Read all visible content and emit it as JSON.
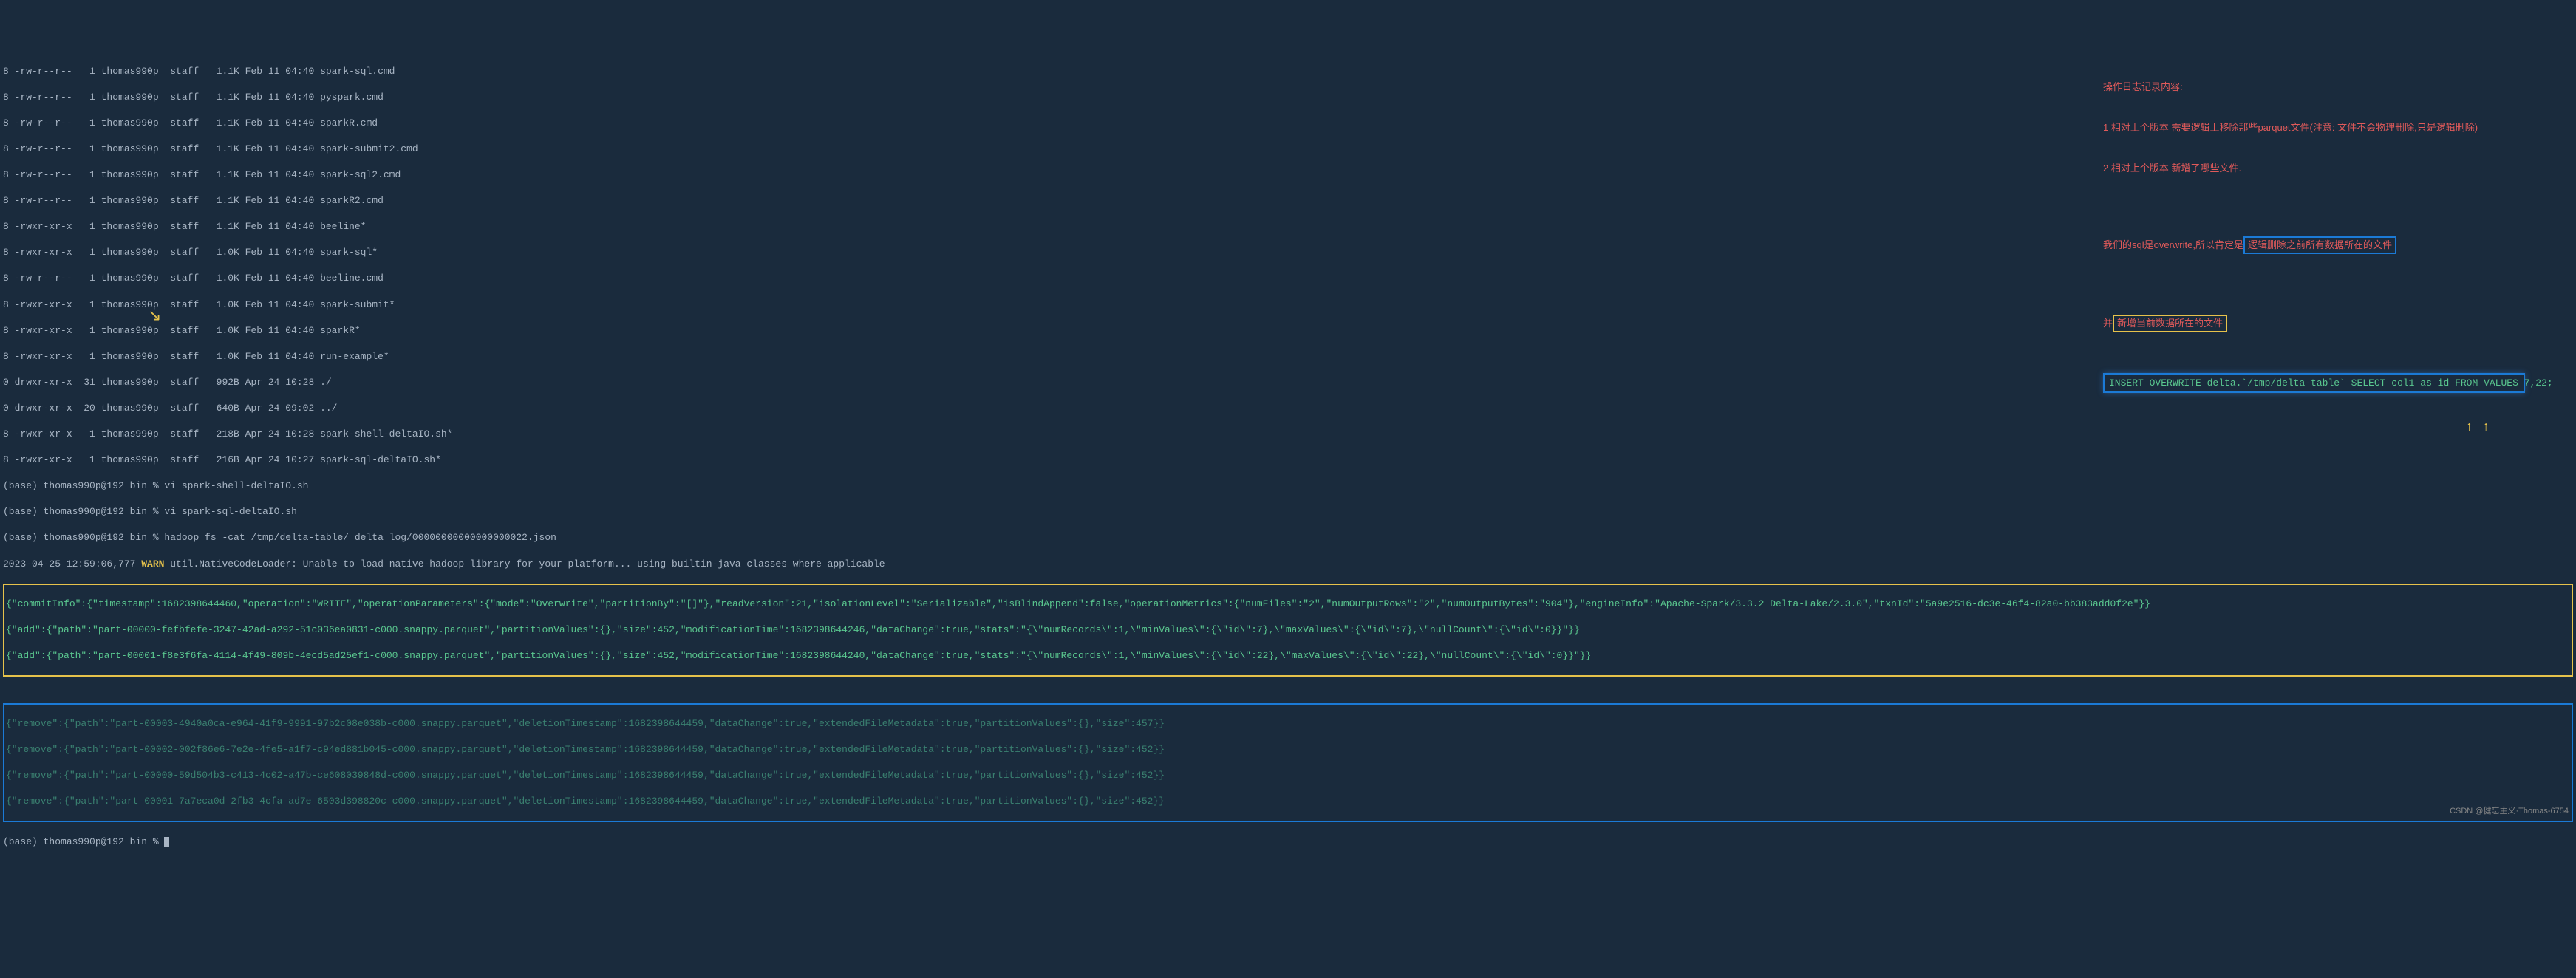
{
  "listing": [
    "8 -rw-r--r--   1 thomas990p  staff   1.1K Feb 11 04:40 spark-sql.cmd",
    "8 -rw-r--r--   1 thomas990p  staff   1.1K Feb 11 04:40 pyspark.cmd",
    "8 -rw-r--r--   1 thomas990p  staff   1.1K Feb 11 04:40 sparkR.cmd",
    "8 -rw-r--r--   1 thomas990p  staff   1.1K Feb 11 04:40 spark-submit2.cmd",
    "8 -rw-r--r--   1 thomas990p  staff   1.1K Feb 11 04:40 spark-sql2.cmd",
    "8 -rw-r--r--   1 thomas990p  staff   1.1K Feb 11 04:40 sparkR2.cmd",
    "8 -rwxr-xr-x   1 thomas990p  staff   1.1K Feb 11 04:40 beeline*",
    "8 -rwxr-xr-x   1 thomas990p  staff   1.0K Feb 11 04:40 spark-sql*",
    "8 -rw-r--r--   1 thomas990p  staff   1.0K Feb 11 04:40 beeline.cmd",
    "8 -rwxr-xr-x   1 thomas990p  staff   1.0K Feb 11 04:40 spark-submit*",
    "8 -rwxr-xr-x   1 thomas990p  staff   1.0K Feb 11 04:40 sparkR*",
    "8 -rwxr-xr-x   1 thomas990p  staff   1.0K Feb 11 04:40 run-example*",
    "0 drwxr-xr-x  31 thomas990p  staff   992B Apr 24 10:28 ./",
    "0 drwxr-xr-x  20 thomas990p  staff   640B Apr 24 09:02 ../",
    "8 -rwxr-xr-x   1 thomas990p  staff   218B Apr 24 10:28 spark-shell-deltaIO.sh*",
    "8 -rwxr-xr-x   1 thomas990p  staff   216B Apr 24 10:27 spark-sql-deltaIO.sh*"
  ],
  "prompts": {
    "p1": "(base) thomas990p@192 bin % vi spark-shell-deltaIO.sh",
    "p2": "(base) thomas990p@192 bin % vi spark-sql-deltaIO.sh",
    "p3": "(base) thomas990p@192 bin % hadoop fs -cat /tmp/delta-table/_delta_log/00000000000000000022.json",
    "p4": "(base) thomas990p@192 bin % "
  },
  "warn_line": {
    "prefix": "2023-04-25 12:59:06,777 ",
    "warn": "WARN",
    "suffix": " util.NativeCodeLoader: Unable to load native-hadoop library for your platform... using builtin-java classes where applicable"
  },
  "json_commit": "{\"commitInfo\":{\"timestamp\":1682398644460,\"operation\":\"WRITE\",\"operationParameters\":{\"mode\":\"Overwrite\",\"partitionBy\":\"[]\"},\"readVersion\":21,\"isolationLevel\":\"Serializable\",\"isBlindAppend\":false,\"operationMetrics\":{\"numFiles\":\"2\",\"numOutputRows\":\"2\",\"numOutputBytes\":\"904\"},\"engineInfo\":\"Apache-Spark/3.3.2 Delta-Lake/2.3.0\",\"txnId\":\"5a9e2516-dc3e-46f4-82a0-bb383add0f2e\"}}",
  "json_add1": "{\"add\":{\"path\":\"part-00000-fefbfefe-3247-42ad-a292-51c036ea0831-c000.snappy.parquet\",\"partitionValues\":{},\"size\":452,\"modificationTime\":1682398644246,\"dataChange\":true,\"stats\":\"{\\\"numRecords\\\":1,\\\"minValues\\\":{\\\"id\\\":7},\\\"maxValues\\\":{\\\"id\\\":7},\\\"nullCount\\\":{\\\"id\\\":0}}\"}}",
  "json_add2": "{\"add\":{\"path\":\"part-00001-f8e3f6fa-4114-4f49-809b-4ecd5ad25ef1-c000.snappy.parquet\",\"partitionValues\":{},\"size\":452,\"modificationTime\":1682398644240,\"dataChange\":true,\"stats\":\"{\\\"numRecords\\\":1,\\\"minValues\\\":{\\\"id\\\":22},\\\"maxValues\\\":{\\\"id\\\":22},\\\"nullCount\\\":{\\\"id\\\":0}}\"}}",
  "json_remove1": "{\"remove\":{\"path\":\"part-00003-4940a0ca-e964-41f9-9991-97b2c08e038b-c000.snappy.parquet\",\"deletionTimestamp\":1682398644459,\"dataChange\":true,\"extendedFileMetadata\":true,\"partitionValues\":{},\"size\":457}}",
  "json_remove2": "{\"remove\":{\"path\":\"part-00002-002f86e6-7e2e-4fe5-a1f7-c94ed881b045-c000.snappy.parquet\",\"deletionTimestamp\":1682398644459,\"dataChange\":true,\"extendedFileMetadata\":true,\"partitionValues\":{},\"size\":452}}",
  "json_remove3": "{\"remove\":{\"path\":\"part-00000-59d504b3-c413-4c02-a47b-ce608039848d-c000.snappy.parquet\",\"deletionTimestamp\":1682398644459,\"dataChange\":true,\"extendedFileMetadata\":true,\"partitionValues\":{},\"size\":452}}",
  "json_remove4": "{\"remove\":{\"path\":\"part-00001-7a7eca0d-2fb3-4cfa-ad7e-6503d398820c-c000.snappy.parquet\",\"deletionTimestamp\":1682398644459,\"dataChange\":true,\"extendedFileMetadata\":true,\"partitionValues\":{},\"size\":452}}",
  "notes": {
    "title": "操作日志记录内容:",
    "line1": "1 相对上个版本 需要逻辑上移除那些parquet文件(注意: 文件不会物理删除,只是逻辑删除)",
    "line2": "2 相对上个版本 新增了哪些文件.",
    "line3_prefix": "我们的sql是overwrite,所以肯定是",
    "line3_box": "逻辑删除之前所有数据所在的文件",
    "line4_prefix": "并",
    "line4_box": "新增当前数据所在的文件",
    "sql": "INSERT OVERWRITE delta.`/tmp/delta-table` SELECT col1 as id FROM VALUES 7,22;"
  },
  "watermark": "CSDN @健忘主义·Thomas-6754"
}
